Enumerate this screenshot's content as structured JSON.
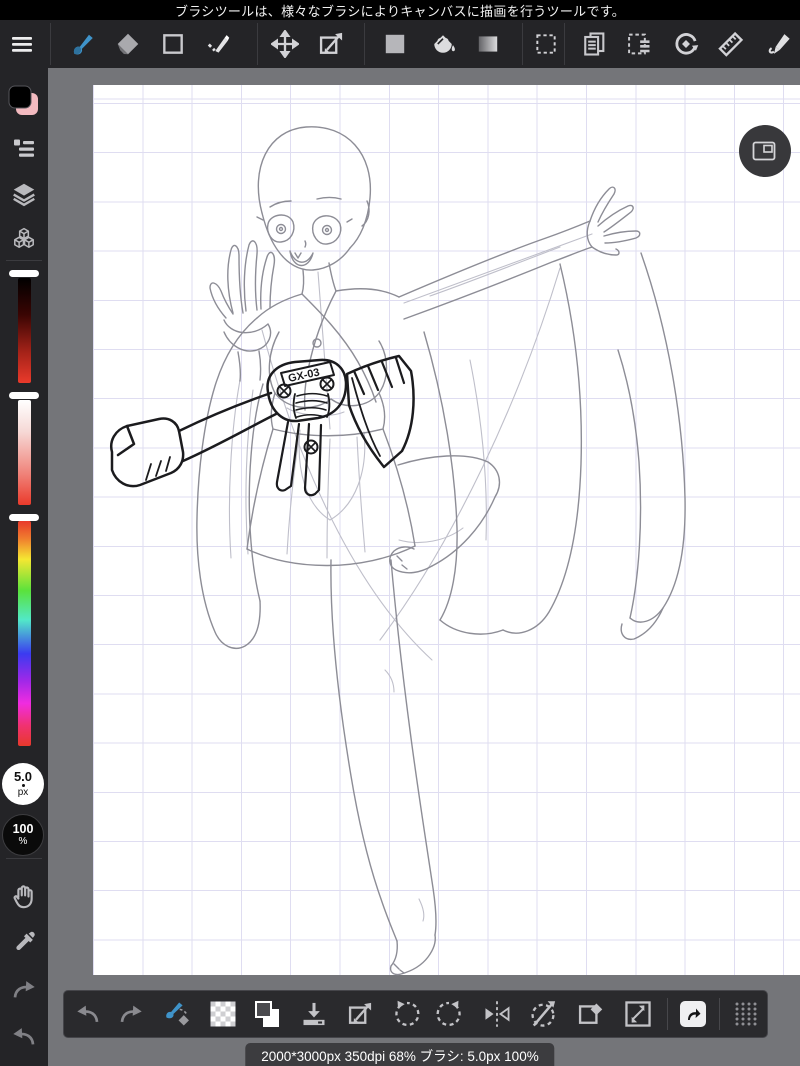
{
  "header": {
    "message": "ブラシツールは、様々なブラシによりキャンバスに描画を行うツールです。"
  },
  "colors": {
    "accent_blue": "#3f93c9",
    "toolbar_bg": "#242427",
    "canvas_surround": "#747579",
    "grid_line": "#dfddf1",
    "status_pill_bg": "#3c3c3f",
    "foreground_swatch": "#000000",
    "background_swatch": "#f3bac0"
  },
  "top_toolbar": {
    "icons": [
      "hamburger-menu",
      "brush-tool",
      "eraser-tool",
      "shape-rect-tool",
      "curve-snap-tool",
      "move-tool",
      "transform-tool",
      "fill-rect-tool",
      "bucket-tool",
      "gradient-tool",
      "marquee-select-tool",
      "copy-layer-tool",
      "layer-select-tool",
      "rotate-canvas-tool",
      "ruler-tool",
      "material-pen-tool"
    ]
  },
  "sidebar": {
    "icons": [
      "color-swatch",
      "brush-panel",
      "layers-panel",
      "materials-panel",
      "pan-tool",
      "eyedropper-tool",
      "redo",
      "undo"
    ],
    "brush_size": {
      "value": "5.0",
      "unit": "px"
    },
    "opacity": {
      "value": "100",
      "unit": "%"
    }
  },
  "canvas": {
    "device_label": "GX-03"
  },
  "bottom_toolbar": {
    "icons": [
      "undo",
      "redo",
      "brush-eraser-toggle",
      "transparent-bg-swatch",
      "layer-color-swatch",
      "save-export",
      "transform",
      "rotate-ccw",
      "rotate-cw",
      "flip-horizontal",
      "reset-rotation",
      "clear-rotation",
      "fit-screen",
      "open-fullscreen",
      "drag-handle"
    ]
  },
  "status_bar": {
    "text": "2000*3000px 350dpi 68% ブラシ: 5.0px 100%"
  }
}
